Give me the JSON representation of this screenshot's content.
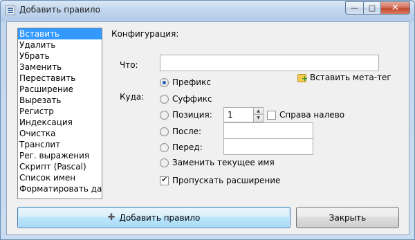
{
  "window": {
    "title": "Добавить правило",
    "controls": {
      "minimize": "—",
      "maximize": "□",
      "close": "✕"
    }
  },
  "rules": {
    "selected_index": 0,
    "items": [
      "Вставить",
      "Удалить",
      "Убрать",
      "Заменить",
      "Переставить",
      "Расширение",
      "Вырезать",
      "Регистр",
      "Индексация",
      "Очистка",
      "Транслит",
      "Рег. выражения",
      "Скрипт (Pascal)",
      "Список имен",
      "Форматировать дату"
    ]
  },
  "config": {
    "section_label": "Конфигурация:",
    "what_label": "Что:",
    "what_value": "",
    "meta_tag_label": "Вставить мета-тег",
    "where_label": "Куда:",
    "options": {
      "prefix": "Префикс",
      "suffix": "Суффикс",
      "position": "Позиция:",
      "after": "После:",
      "before": "Перед:",
      "replace": "Заменить текущее имя"
    },
    "selected_option": "prefix",
    "position_value": "1",
    "right_to_left_label": "Справа налево",
    "right_to_left_checked": false,
    "after_value": "",
    "before_value": "",
    "skip_extension_label": "Пропускать расширение",
    "skip_extension_checked": true
  },
  "footer": {
    "add_rule_label": "Добавить правило",
    "close_label": "Закрыть"
  }
}
